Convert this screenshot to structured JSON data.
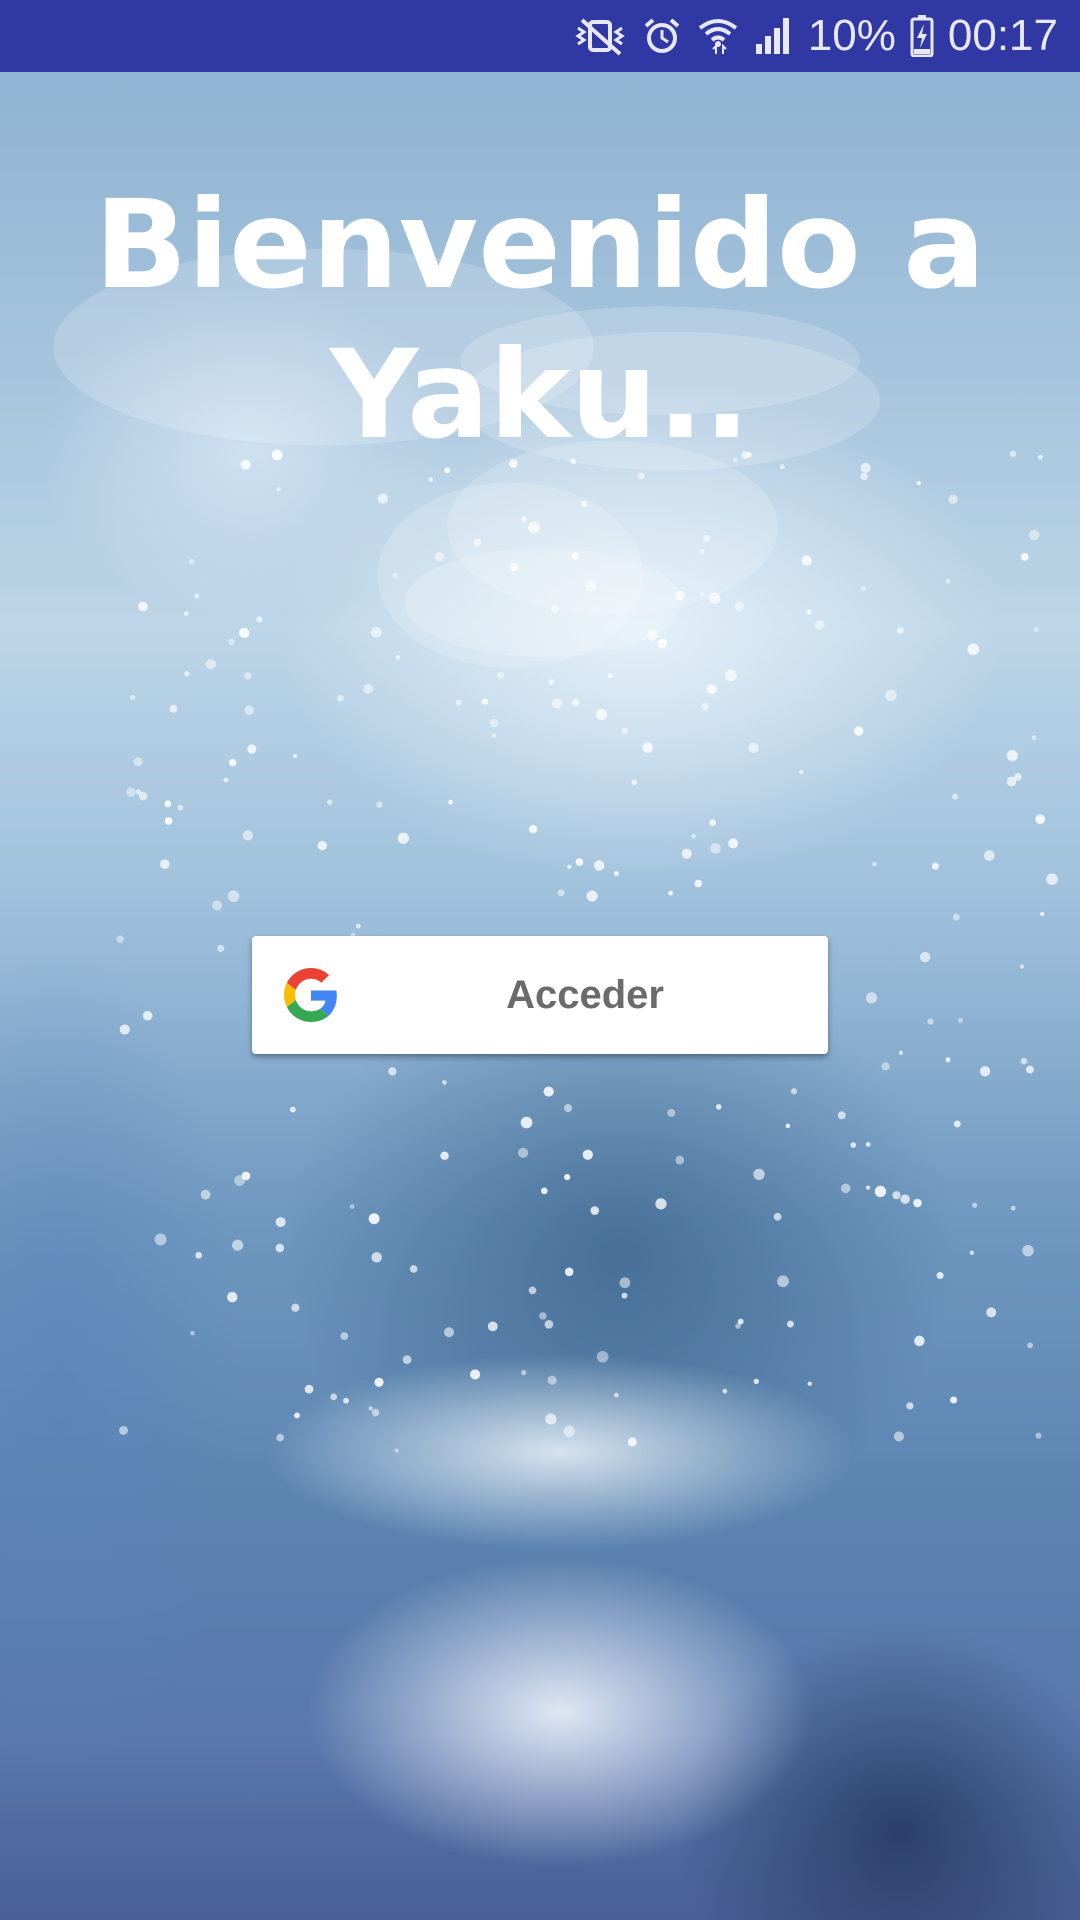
{
  "status_bar": {
    "battery_percent": "10%",
    "time": "00:17",
    "background_color": "#3038a4",
    "icons": [
      "mute-vibrate-icon",
      "alarm-icon",
      "wifi-icon",
      "signal-icon",
      "battery-charging-icon"
    ]
  },
  "welcome": {
    "line1": "Bienvenido a",
    "line2": "Yaku.."
  },
  "signin": {
    "label": "Acceder",
    "icon": "google-icon"
  }
}
